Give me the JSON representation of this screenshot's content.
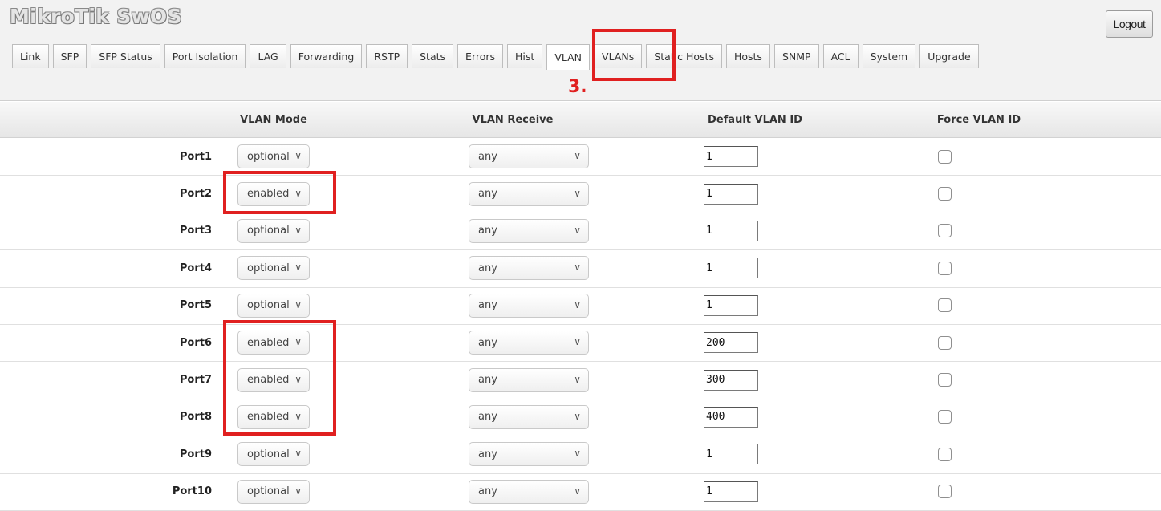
{
  "app": {
    "title": "MikroTik SwOS",
    "logout_label": "Logout"
  },
  "tabs": [
    {
      "label": "Link"
    },
    {
      "label": "SFP"
    },
    {
      "label": "SFP Status"
    },
    {
      "label": "Port Isolation"
    },
    {
      "label": "LAG"
    },
    {
      "label": "Forwarding"
    },
    {
      "label": "RSTP"
    },
    {
      "label": "Stats"
    },
    {
      "label": "Errors"
    },
    {
      "label": "Hist"
    },
    {
      "label": "VLAN"
    },
    {
      "label": "VLANs"
    },
    {
      "label": "Static Hosts"
    },
    {
      "label": "Hosts"
    },
    {
      "label": "SNMP"
    },
    {
      "label": "ACL"
    },
    {
      "label": "System"
    },
    {
      "label": "Upgrade"
    }
  ],
  "active_tab": "VLAN",
  "annotation": {
    "step_label": "3.",
    "color": "#e02020"
  },
  "table": {
    "headers": {
      "mode": "VLAN Mode",
      "receive": "VLAN Receive",
      "default_id": "Default VLAN ID",
      "force": "Force VLAN ID"
    },
    "rows": [
      {
        "port": "Port1",
        "mode": "optional",
        "receive": "any",
        "default_id": "1",
        "force": false
      },
      {
        "port": "Port2",
        "mode": "enabled",
        "receive": "any",
        "default_id": "1",
        "force": false
      },
      {
        "port": "Port3",
        "mode": "optional",
        "receive": "any",
        "default_id": "1",
        "force": false
      },
      {
        "port": "Port4",
        "mode": "optional",
        "receive": "any",
        "default_id": "1",
        "force": false
      },
      {
        "port": "Port5",
        "mode": "optional",
        "receive": "any",
        "default_id": "1",
        "force": false
      },
      {
        "port": "Port6",
        "mode": "enabled",
        "receive": "any",
        "default_id": "200",
        "force": false
      },
      {
        "port": "Port7",
        "mode": "enabled",
        "receive": "any",
        "default_id": "300",
        "force": false
      },
      {
        "port": "Port8",
        "mode": "enabled",
        "receive": "any",
        "default_id": "400",
        "force": false
      },
      {
        "port": "Port9",
        "mode": "optional",
        "receive": "any",
        "default_id": "1",
        "force": false
      },
      {
        "port": "Port10",
        "mode": "optional",
        "receive": "any",
        "default_id": "1",
        "force": false
      }
    ]
  }
}
